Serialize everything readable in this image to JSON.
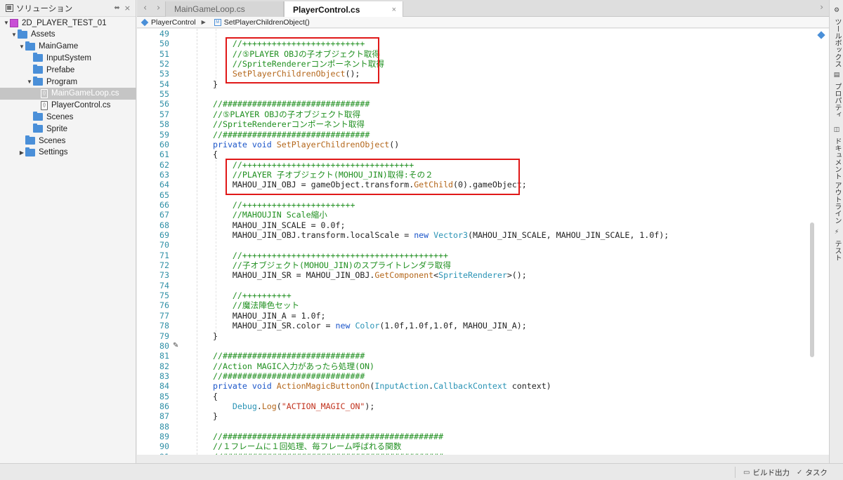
{
  "sidebar": {
    "title": "ソリューション",
    "pin_icon": "⬌",
    "close_icon": "×",
    "tree": [
      {
        "label": "2D_PLAYER_TEST_01",
        "kind": "solution",
        "depth": 0,
        "expanded": true
      },
      {
        "label": "Assets",
        "kind": "folder",
        "depth": 1,
        "expanded": true
      },
      {
        "label": "MainGame",
        "kind": "folder",
        "depth": 2,
        "expanded": true
      },
      {
        "label": "InputSystem",
        "kind": "folder",
        "depth": 3
      },
      {
        "label": "Prefabe",
        "kind": "folder",
        "depth": 3
      },
      {
        "label": "Program",
        "kind": "folder",
        "depth": 3,
        "expanded": true
      },
      {
        "label": "MainGameLoop.cs",
        "kind": "file",
        "depth": 4,
        "selected": true
      },
      {
        "label": "PlayerControl.cs",
        "kind": "file",
        "depth": 4
      },
      {
        "label": "Scenes",
        "kind": "folder",
        "depth": 3
      },
      {
        "label": "Sprite",
        "kind": "folder",
        "depth": 3
      },
      {
        "label": "Scenes",
        "kind": "folder",
        "depth": 2
      },
      {
        "label": "Settings",
        "kind": "folder",
        "depth": 2,
        "collapsed": true
      }
    ]
  },
  "tabs": [
    {
      "label": "MainGameLoop.cs",
      "active": false
    },
    {
      "label": "PlayerControl.cs",
      "active": true,
      "close": "×"
    }
  ],
  "breadcrumb": {
    "class_name": "PlayerControl",
    "method_name": "SetPlayerChildrenObject()",
    "class_icon": "class-icon",
    "method_icon": "method-icon"
  },
  "editor": {
    "lines": [
      {
        "n": "49",
        "tokens": [
          [
            "",
            ""
          ]
        ]
      },
      {
        "n": "50",
        "tokens": [
          [
            "com",
            "    //+++++++++++++++++++++++++"
          ]
        ]
      },
      {
        "n": "51",
        "tokens": [
          [
            "com",
            "    //⑤PLAYER OBJの子オブジェクト取得"
          ]
        ]
      },
      {
        "n": "52",
        "tokens": [
          [
            "com",
            "    //SpriteRendererコンポーネント取得"
          ]
        ]
      },
      {
        "n": "53",
        "tokens": [
          [
            "fn",
            "    SetPlayerChildrenObject"
          ],
          [
            "",
            "();"
          ]
        ]
      },
      {
        "n": "54",
        "tokens": [
          [
            "",
            "}"
          ]
        ]
      },
      {
        "n": "55",
        "tokens": [
          [
            "",
            ""
          ]
        ]
      },
      {
        "n": "56",
        "tokens": [
          [
            "com",
            "//##############################"
          ]
        ]
      },
      {
        "n": "57",
        "tokens": [
          [
            "com",
            "//⑤PLAYER OBJの子オブジェクト取得"
          ]
        ]
      },
      {
        "n": "58",
        "tokens": [
          [
            "com",
            "//SpriteRendererコンポーネント取得"
          ]
        ]
      },
      {
        "n": "59",
        "tokens": [
          [
            "com",
            "//##############################"
          ]
        ]
      },
      {
        "n": "60",
        "tokens": [
          [
            "kw",
            "private void "
          ],
          [
            "fn",
            "SetPlayerChildrenObject"
          ],
          [
            "",
            "()"
          ]
        ]
      },
      {
        "n": "61",
        "tokens": [
          [
            "",
            "{"
          ]
        ]
      },
      {
        "n": "62",
        "tokens": [
          [
            "com",
            "    //+++++++++++++++++++++++++++++++++++"
          ]
        ]
      },
      {
        "n": "63",
        "tokens": [
          [
            "com",
            "    //PLAYER 子オブジェクト(MOHOU_JIN)取得:その２"
          ]
        ]
      },
      {
        "n": "64",
        "tokens": [
          [
            "",
            "    MAHOU_JIN_OBJ = gameObject.transform."
          ],
          [
            "fn",
            "GetChild"
          ],
          [
            "",
            "(0).gameObject;"
          ]
        ]
      },
      {
        "n": "65",
        "tokens": [
          [
            "",
            ""
          ]
        ]
      },
      {
        "n": "66",
        "tokens": [
          [
            "com",
            "    //+++++++++++++++++++++++"
          ]
        ]
      },
      {
        "n": "67",
        "tokens": [
          [
            "com",
            "    //MAHOUJIN Scale縮小"
          ]
        ]
      },
      {
        "n": "68",
        "tokens": [
          [
            "",
            "    MAHOU_JIN_SCALE = 0.0f;"
          ]
        ]
      },
      {
        "n": "69",
        "tokens": [
          [
            "",
            "    MAHOU_JIN_OBJ.transform.localScale = "
          ],
          [
            "kw",
            "new "
          ],
          [
            "ty",
            "Vector3"
          ],
          [
            "",
            "(MAHOU_JIN_SCALE, MAHOU_JIN_SCALE, 1.0f);"
          ]
        ]
      },
      {
        "n": "70",
        "tokens": [
          [
            "",
            ""
          ]
        ]
      },
      {
        "n": "71",
        "tokens": [
          [
            "com",
            "    //++++++++++++++++++++++++++++++++++++++++++"
          ]
        ]
      },
      {
        "n": "72",
        "tokens": [
          [
            "com",
            "    //子オブジェクト(MOHOU_JIN)のスプライトレンダラ取得"
          ]
        ]
      },
      {
        "n": "73",
        "tokens": [
          [
            "",
            "    MAHOU_JIN_SR = MAHOU_JIN_OBJ."
          ],
          [
            "fn",
            "GetComponent"
          ],
          [
            "",
            "<"
          ],
          [
            "ty",
            "SpriteRenderer"
          ],
          [
            "",
            ">();"
          ]
        ]
      },
      {
        "n": "74",
        "tokens": [
          [
            "",
            ""
          ]
        ]
      },
      {
        "n": "75",
        "tokens": [
          [
            "com",
            "    //++++++++++"
          ]
        ]
      },
      {
        "n": "76",
        "tokens": [
          [
            "com",
            "    //魔法陣色セット"
          ]
        ]
      },
      {
        "n": "77",
        "tokens": [
          [
            "",
            "    MAHOU_JIN_A = 1.0f;"
          ]
        ]
      },
      {
        "n": "78",
        "tokens": [
          [
            "",
            "    MAHOU_JIN_SR.color = "
          ],
          [
            "kw",
            "new "
          ],
          [
            "ty",
            "Color"
          ],
          [
            "",
            "(1.0f,1.0f,1.0f, MAHOU_JIN_A);"
          ]
        ]
      },
      {
        "n": "79",
        "tokens": [
          [
            "",
            "}"
          ]
        ]
      },
      {
        "n": "80",
        "tokens": [
          [
            "",
            ""
          ]
        ]
      },
      {
        "n": "81",
        "tokens": [
          [
            "com",
            "//#############################"
          ]
        ]
      },
      {
        "n": "82",
        "tokens": [
          [
            "com",
            "//Action MAGIC入力があったら処理(ON)"
          ]
        ]
      },
      {
        "n": "83",
        "tokens": [
          [
            "com",
            "//#############################"
          ]
        ]
      },
      {
        "n": "84",
        "tokens": [
          [
            "kw",
            "private void "
          ],
          [
            "fn",
            "ActionMagicButtonOn"
          ],
          [
            "",
            "("
          ],
          [
            "ty",
            "InputAction"
          ],
          [
            "",
            "."
          ],
          [
            "ty",
            "CallbackContext"
          ],
          [
            "",
            " context)"
          ]
        ]
      },
      {
        "n": "85",
        "tokens": [
          [
            "",
            "{"
          ]
        ]
      },
      {
        "n": "86",
        "tokens": [
          [
            "ty",
            "    Debug"
          ],
          [
            "",
            "."
          ],
          [
            "fn",
            "Log"
          ],
          [
            "",
            "("
          ],
          [
            "str",
            "\"ACTION_MAGIC_ON\""
          ],
          [
            "",
            ");"
          ]
        ]
      },
      {
        "n": "87",
        "tokens": [
          [
            "",
            "}"
          ]
        ]
      },
      {
        "n": "88",
        "tokens": [
          [
            "",
            ""
          ]
        ]
      },
      {
        "n": "89",
        "tokens": [
          [
            "com",
            "//#############################################"
          ]
        ]
      },
      {
        "n": "90",
        "tokens": [
          [
            "com",
            "//１フレームに１回処理、毎フレーム呼ばれる関数"
          ]
        ]
      },
      {
        "n": "91",
        "tokens": [
          [
            "com",
            "//#############################################"
          ]
        ]
      }
    ]
  },
  "right_tools": [
    {
      "label": "ツールボックス",
      "icon": "toolbox-icon"
    },
    {
      "label": "プロパティ",
      "icon": "properties-icon"
    },
    {
      "label": "ドキュメント アウトライン",
      "icon": "outline-icon"
    },
    {
      "label": "テスト",
      "icon": "test-icon"
    }
  ],
  "statusbar": {
    "build_output": "ビルド出力",
    "tasks": "タスク"
  },
  "colors": {
    "comment": "#1f8f1f",
    "keyword": "#1b55c9",
    "function": "#b4671b",
    "type": "#2a93b5",
    "string": "#c1311c",
    "line_number": "#2f8fa6",
    "highlight_box": "#e01818",
    "folder": "#4a8fd8"
  }
}
